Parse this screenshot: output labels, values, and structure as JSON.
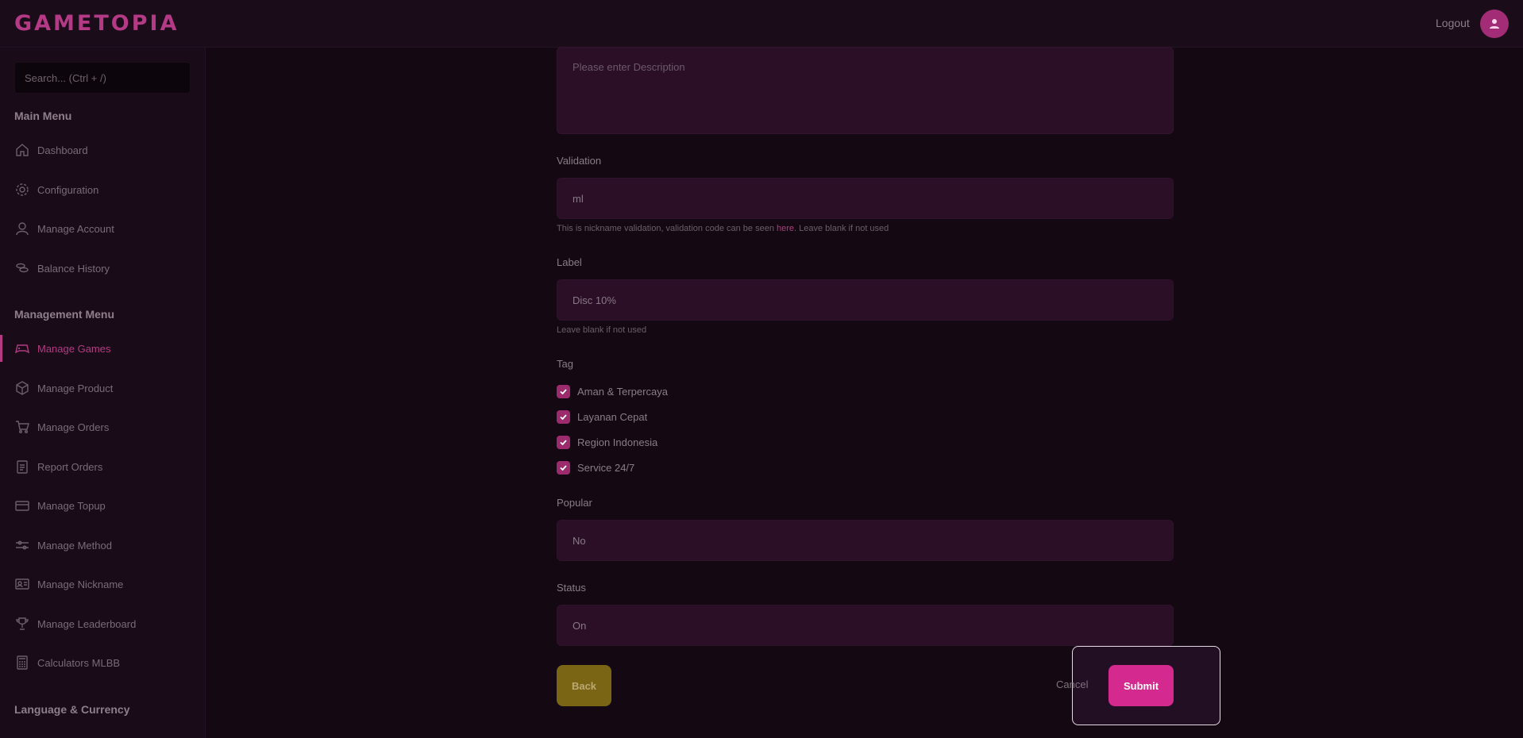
{
  "app": {
    "logo": "GAMETOPIA",
    "logout": "Logout"
  },
  "sidebar": {
    "search_placeholder": "Search... (Ctrl + /)",
    "main_menu_title": "Main Menu",
    "main_items": [
      {
        "label": "Dashboard",
        "icon": "home-icon"
      },
      {
        "label": "Configuration",
        "icon": "gear-icon"
      },
      {
        "label": "Manage Account",
        "icon": "user-icon"
      },
      {
        "label": "Balance History",
        "icon": "coins-icon"
      }
    ],
    "management_menu_title": "Management Menu",
    "management_items": [
      {
        "label": "Manage Games",
        "icon": "gamepad-icon",
        "active": true
      },
      {
        "label": "Manage Product",
        "icon": "box-icon"
      },
      {
        "label": "Manage Orders",
        "icon": "cart-icon"
      },
      {
        "label": "Report Orders",
        "icon": "clipboard-icon"
      },
      {
        "label": "Manage Topup",
        "icon": "card-icon"
      },
      {
        "label": "Manage Method",
        "icon": "sliders-icon"
      },
      {
        "label": "Manage Nickname",
        "icon": "id-card-icon"
      },
      {
        "label": "Manage Leaderboard",
        "icon": "trophy-icon"
      },
      {
        "label": "Calculators MLBB",
        "icon": "calculator-icon"
      }
    ],
    "language_title": "Language & Currency"
  },
  "form": {
    "description_placeholder": "Please enter Description",
    "validation": {
      "label": "Validation",
      "value": "ml",
      "help_before": "This is nickname validation, validation code can be seen ",
      "help_link": "here",
      "help_after": ". Leave blank if not used"
    },
    "label_field": {
      "label": "Label",
      "value": "Disc 10%",
      "help": "Leave blank if not used"
    },
    "tag": {
      "label": "Tag",
      "options": [
        {
          "label": "Aman & Terpercaya",
          "checked": true
        },
        {
          "label": "Layanan Cepat",
          "checked": true
        },
        {
          "label": "Region Indonesia",
          "checked": true
        },
        {
          "label": "Service 24/7",
          "checked": true
        }
      ]
    },
    "popular": {
      "label": "Popular",
      "value": "No"
    },
    "status": {
      "label": "Status",
      "value": "On"
    },
    "buttons": {
      "back": "Back",
      "cancel": "Cancel",
      "submit": "Submit"
    }
  },
  "colors": {
    "accent": "#d42a8f",
    "background": "#140912",
    "input_bg": "#2a0f27",
    "back_button": "#7a6515"
  }
}
